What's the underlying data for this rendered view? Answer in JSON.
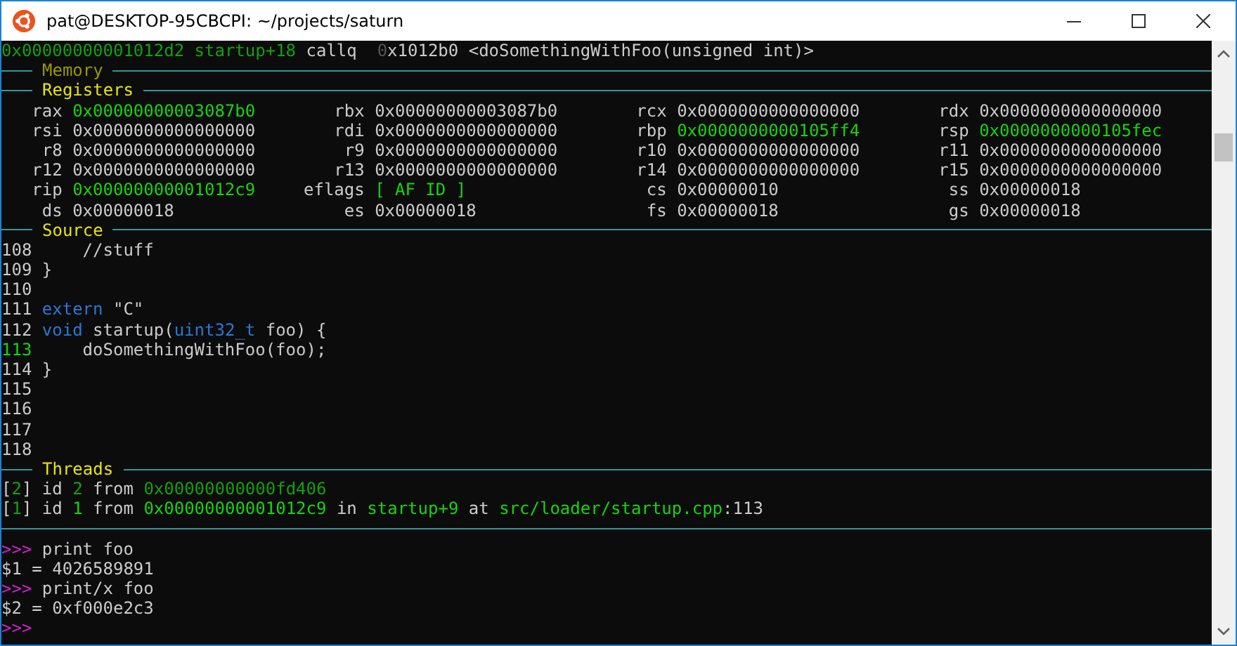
{
  "window": {
    "title": "pat@DESKTOP-95CBCPI: ~/projects/saturn"
  },
  "disassembly": {
    "segments": [
      {
        "kind": "addr",
        "text": "0x00000000001012d2 startup+18"
      },
      {
        "kind": "text",
        "text": " callq  "
      },
      {
        "kind": "faint",
        "text": "0"
      },
      {
        "kind": "text",
        "text": "x1012b0 <doSomethingWithFoo(unsigned int)>"
      }
    ]
  },
  "memory": {
    "title": "Memory",
    "dimmed": true
  },
  "registers": {
    "title": "Registers",
    "dimmed": false,
    "items": [
      {
        "name": "rax",
        "value": "0x00000000003087b0",
        "changed": true
      },
      {
        "name": "rbx",
        "value": "0x00000000003087b0",
        "changed": false
      },
      {
        "name": "rcx",
        "value": "0x0000000000000000",
        "changed": false
      },
      {
        "name": "rdx",
        "value": "0x0000000000000000",
        "changed": false
      },
      {
        "name": "rsi",
        "value": "0x0000000000000000",
        "changed": false
      },
      {
        "name": "rdi",
        "value": "0x0000000000000000",
        "changed": false
      },
      {
        "name": "rbp",
        "value": "0x0000000000105ff4",
        "changed": true
      },
      {
        "name": "rsp",
        "value": "0x0000000000105fec",
        "changed": true
      },
      {
        "name": "r8",
        "value": "0x0000000000000000",
        "changed": false
      },
      {
        "name": "r9",
        "value": "0x0000000000000000",
        "changed": false
      },
      {
        "name": "r10",
        "value": "0x0000000000000000",
        "changed": false
      },
      {
        "name": "r11",
        "value": "0x0000000000000000",
        "changed": false
      },
      {
        "name": "r12",
        "value": "0x0000000000000000",
        "changed": false
      },
      {
        "name": "r13",
        "value": "0x0000000000000000",
        "changed": false
      },
      {
        "name": "r14",
        "value": "0x0000000000000000",
        "changed": false
      },
      {
        "name": "r15",
        "value": "0x0000000000000000",
        "changed": false
      },
      {
        "name": "rip",
        "value": "0x00000000001012c9",
        "changed": true
      },
      {
        "name": "eflags",
        "value": "[ AF ID ]",
        "changed": true
      },
      {
        "name": "cs",
        "value": "0x00000010",
        "changed": false
      },
      {
        "name": "ss",
        "value": "0x00000018",
        "changed": false
      },
      {
        "name": "ds",
        "value": "0x00000018",
        "changed": false
      },
      {
        "name": "es",
        "value": "0x00000018",
        "changed": false
      },
      {
        "name": "fs",
        "value": "0x00000018",
        "changed": false
      },
      {
        "name": "gs",
        "value": "0x00000018",
        "changed": false
      }
    ]
  },
  "source": {
    "title": "Source",
    "dimmed": false,
    "lines": [
      {
        "number": "108",
        "current": false,
        "segments": [
          {
            "kind": "text",
            "text": "    //stuff"
          }
        ]
      },
      {
        "number": "109",
        "current": false,
        "segments": [
          {
            "kind": "text",
            "text": "}"
          }
        ]
      },
      {
        "number": "110",
        "current": false
      },
      {
        "number": "111",
        "current": false,
        "segments": [
          {
            "kind": "kw",
            "text": "extern"
          },
          {
            "kind": "text",
            "text": " \"C\""
          }
        ]
      },
      {
        "number": "112",
        "current": false,
        "segments": [
          {
            "kind": "kw",
            "text": "void"
          },
          {
            "kind": "text",
            "text": " startup("
          },
          {
            "kind": "kw",
            "text": "uint32_t"
          },
          {
            "kind": "text",
            "text": " foo) {"
          }
        ]
      },
      {
        "number": "113",
        "current": true,
        "segments": [
          {
            "kind": "text",
            "text": "    doSomethingWithFoo(foo);"
          }
        ]
      },
      {
        "number": "114",
        "current": false,
        "segments": [
          {
            "kind": "text",
            "text": "}"
          }
        ]
      },
      {
        "number": "115",
        "current": false
      },
      {
        "number": "116",
        "current": false
      },
      {
        "number": "117",
        "current": false
      },
      {
        "number": "118",
        "current": false
      }
    ]
  },
  "threads": {
    "title": "Threads",
    "dimmed": false,
    "lines": [
      {
        "segments": [
          {
            "kind": "text",
            "text": "["
          },
          {
            "kind": "addr",
            "text": "2"
          },
          {
            "kind": "text",
            "text": "] id "
          },
          {
            "kind": "addr",
            "text": "2"
          },
          {
            "kind": "text",
            "text": " from "
          },
          {
            "kind": "addr",
            "text": "0x00000000000fd406"
          }
        ]
      },
      {
        "segments": [
          {
            "kind": "text",
            "text": "["
          },
          {
            "kind": "addr",
            "text": "1"
          },
          {
            "kind": "text",
            "text": "] id "
          },
          {
            "kind": "hi",
            "text": "1"
          },
          {
            "kind": "text",
            "text": " from "
          },
          {
            "kind": "hi",
            "text": "0x00000000001012c9"
          },
          {
            "kind": "text",
            "text": " in "
          },
          {
            "kind": "hi",
            "text": "startup+9"
          },
          {
            "kind": "text",
            "text": " at "
          },
          {
            "kind": "hi",
            "text": "src/loader/startup.cpp"
          },
          {
            "kind": "text",
            "text": ":113"
          }
        ]
      }
    ]
  },
  "console": [
    {
      "segments": [
        {
          "kind": "prompt",
          "text": ">>>"
        },
        {
          "kind": "text",
          "text": " print foo"
        }
      ]
    },
    {
      "segments": [
        {
          "kind": "text",
          "text": "$1 = 4026589891"
        }
      ]
    },
    {
      "segments": [
        {
          "kind": "prompt",
          "text": ">>>"
        },
        {
          "kind": "text",
          "text": " print/x foo"
        }
      ]
    },
    {
      "segments": [
        {
          "kind": "text",
          "text": "$2 = 0xf000e2c3"
        }
      ]
    },
    {
      "segments": [
        {
          "kind": "prompt",
          "text": ">>>"
        }
      ]
    }
  ]
}
